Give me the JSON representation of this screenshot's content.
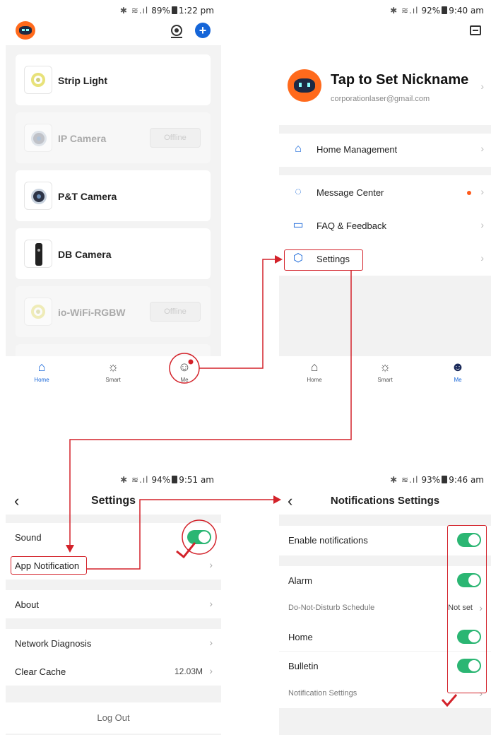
{
  "colors": {
    "accent": "#1565d8",
    "toggle_on": "#2bb673",
    "annotation": "#d3222a",
    "badge": "#ff5a1a",
    "avatar": "#ff6a1c"
  },
  "panel_home": {
    "status": {
      "pct": "89%",
      "time": "1:22 pm"
    },
    "topbar": {
      "logo": "robot-logo",
      "icon_cam": "camera-icon",
      "icon_add": "plus-icon"
    },
    "devices": [
      {
        "name": "Strip Light",
        "icon": "strip-light-icon",
        "offline": false
      },
      {
        "name": "IP Camera",
        "icon": "ip-camera-icon",
        "offline": true,
        "status": "Offline"
      },
      {
        "name": "P&T Camera",
        "icon": "pt-camera-icon",
        "offline": false
      },
      {
        "name": "DB Camera",
        "icon": "doorbell-camera-icon",
        "offline": false
      },
      {
        "name": "io-WiFi-RGBW",
        "icon": "rgbw-icon",
        "offline": true,
        "status": "Offline"
      }
    ],
    "tabs": [
      {
        "label": "Home",
        "icon": "home-icon"
      },
      {
        "label": "Smart",
        "icon": "sun-icon"
      },
      {
        "label": "Me",
        "icon": "user-icon"
      }
    ]
  },
  "panel_me": {
    "status": {
      "pct": "92%",
      "time": "9:40 am"
    },
    "nickname": "Tap to Set Nickname",
    "email": "corporationlaser@gmail.com",
    "menu": [
      {
        "label": "Home Management",
        "icon": "house-icon"
      },
      {
        "label": "Message Center",
        "icon": "chat-icon"
      },
      {
        "label": "FAQ & Feedback",
        "icon": "book-icon"
      },
      {
        "label": "Settings",
        "icon": "hexagon-gear-icon"
      }
    ],
    "tabs": [
      {
        "label": "Home",
        "icon": "home-icon"
      },
      {
        "label": "Smart",
        "icon": "sun-icon"
      },
      {
        "label": "Me",
        "icon": "user-icon"
      }
    ]
  },
  "panel_settings": {
    "status": {
      "pct": "94%",
      "time": "9:51 am"
    },
    "title": "Settings",
    "rows": {
      "sound": "Sound",
      "app_notification": "App Notification",
      "about": "About",
      "network": "Network Diagnosis",
      "cache": "Clear Cache",
      "cache_value": "12.03M"
    },
    "logout": "Log Out"
  },
  "panel_notifications": {
    "status": {
      "pct": "93%",
      "time": "9:46 am"
    },
    "title": "Notifications Settings",
    "rows": {
      "enable": "Enable notifications",
      "alarm": "Alarm",
      "dnd": "Do-Not-Disturb Schedule",
      "dnd_value": "Not set",
      "home": "Home",
      "bulletin": "Bulletin",
      "notif_settings": "Notification Settings"
    }
  }
}
